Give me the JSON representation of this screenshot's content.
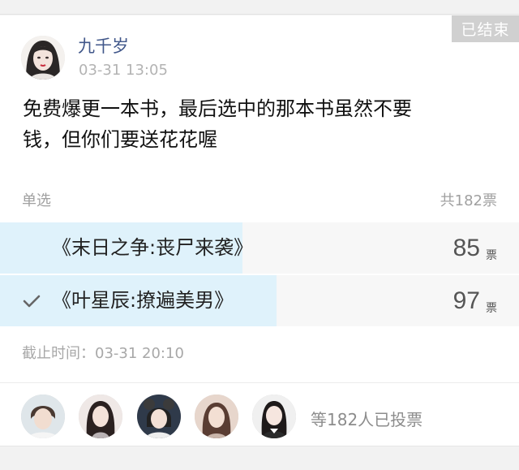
{
  "post": {
    "author": "九千岁",
    "time": "03-31 13:05",
    "text_line1": "免费爆更一本书，最后选中的那本书虽然不要",
    "text_line2": "钱，但你们要送花花喔",
    "status": "已结束"
  },
  "poll": {
    "type": "单选",
    "total": "共182票",
    "options": [
      {
        "label": "《末日之争:丧尸来袭》",
        "votes": "85",
        "unit": "票",
        "share": 0.467,
        "selected": false
      },
      {
        "label": "《叶星辰:撩遍美男》",
        "votes": "97",
        "unit": "票",
        "share": 0.533,
        "selected": true
      }
    ],
    "deadline": "截止时间：03-31 20:10",
    "voters_text": "等182人已投票"
  },
  "icons": {
    "check": "check-icon",
    "avatar": "avatar"
  },
  "colors": {
    "author": "#41578a",
    "vote_fill": "#dff2fb",
    "status_bg": "#d0d0d0"
  }
}
